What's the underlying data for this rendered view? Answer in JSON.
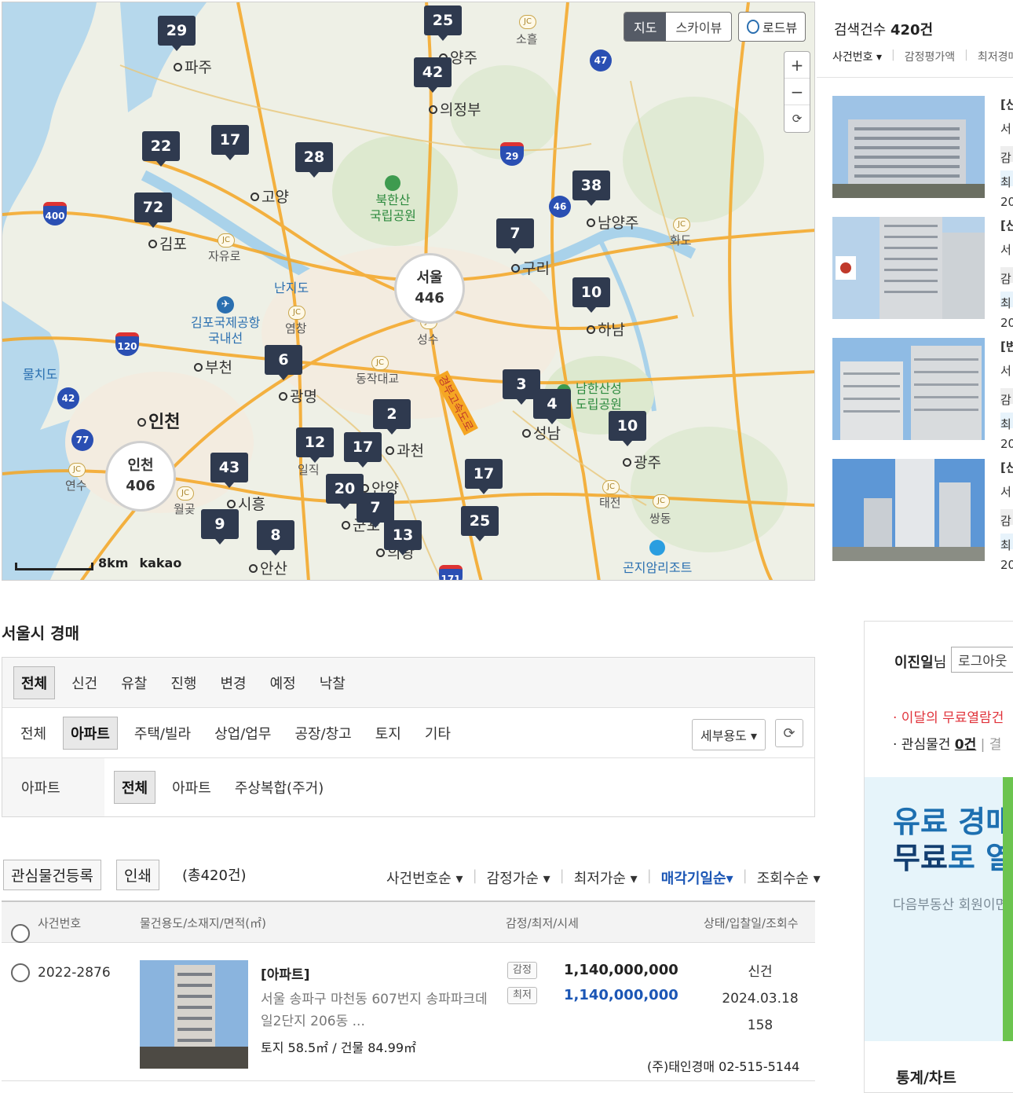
{
  "map": {
    "view_tabs": [
      "지도",
      "스카이뷰"
    ],
    "roadview_label": "로드뷰",
    "zoom_in": "+",
    "zoom_out": "−",
    "reset": "⟳",
    "scale_label": "8km",
    "brand": "kakao",
    "clusters": {
      "seoul": {
        "name": "서울",
        "count": "446"
      },
      "incheon": {
        "name": "인천",
        "count": "406"
      }
    },
    "markers": [
      "29",
      "25",
      "42",
      "22",
      "17",
      "28",
      "72",
      "38",
      "7",
      "10",
      "6",
      "3",
      "4",
      "2",
      "10",
      "12",
      "17",
      "43",
      "20",
      "7",
      "17",
      "25",
      "9",
      "8",
      "13"
    ],
    "cities": [
      "파주",
      "양주",
      "의정부",
      "고양",
      "김포",
      "남양주",
      "구리",
      "하남",
      "부천",
      "광명",
      "인천",
      "성남",
      "과천",
      "광주",
      "시흥",
      "안양",
      "군포",
      "의왕",
      "안산"
    ],
    "jc_labels": [
      "소흘",
      "자유로",
      "염창",
      "동작대교",
      "성수",
      "화도",
      "태전",
      "쌍동",
      "연수",
      "월곶",
      "일직"
    ],
    "parks": [
      "북한산\n국립공원",
      "남한산성\n도립공원",
      "김포국제공항\n국내선",
      "곤지암리조트"
    ],
    "water": [
      "난지도",
      "물치도"
    ],
    "expressway": "경부고속도로",
    "highways": [
      "400",
      "120",
      "42",
      "77",
      "29",
      "46",
      "47",
      "17",
      "171"
    ]
  },
  "results": {
    "count_label": "검색건수",
    "count_value": "420건",
    "sorts": [
      "사건번호 ▾",
      "감정평가액",
      "최저경매"
    ],
    "items": [
      {
        "lines": [
          "[신",
          "서",
          "감",
          "최",
          "20"
        ]
      },
      {
        "lines": [
          "[신",
          "서",
          "감",
          "최",
          "20"
        ]
      },
      {
        "lines": [
          "[변",
          "서",
          "감",
          "최",
          "20"
        ]
      },
      {
        "lines": [
          "[신",
          "서",
          "감",
          "최",
          "20"
        ]
      }
    ]
  },
  "section_title": "서울시 경매",
  "filter": {
    "status_tabs": [
      "전체",
      "신건",
      "유찰",
      "진행",
      "변경",
      "예정",
      "낙찰"
    ],
    "type_tabs": [
      "전체",
      "아파트",
      "주택/빌라",
      "상업/업무",
      "공장/창고",
      "토지",
      "기타"
    ],
    "detail_button": "세부용도 ▾",
    "sub_label": "아파트",
    "sub_tabs": [
      "전체",
      "아파트",
      "주상복합(주거)"
    ]
  },
  "actions": {
    "watch_button": "관심물건등록",
    "print_button": "인쇄",
    "total": "(총420건)",
    "sort_options": [
      "사건번호순 ▾",
      "감정가순 ▾",
      "최저가순 ▾",
      "매각기일순▾",
      "조회수순 ▾"
    ]
  },
  "table": {
    "headers": [
      "사건번호",
      "물건용도/소재지/면적(㎡)",
      "감정/최저/시세",
      "상태/입찰일/조회수"
    ],
    "rows": [
      {
        "case_no": "2022-2876",
        "type": "[아파트]",
        "address": "서울 송파구 마천동 607번지 송파파크데일2단지 206동 ...",
        "area": "토지 58.5㎡ / 건물 84.99㎡",
        "appraisal_label": "감정",
        "appraisal": "1,140,000,000",
        "minimum_label": "최저",
        "minimum": "1,140,000,000",
        "status": "신건",
        "bid_date": "2024.03.18",
        "views": "158",
        "agent": "(주)태인경매 02-515-5144"
      }
    ]
  },
  "side": {
    "user_name": "이진일",
    "user_suffix": "님",
    "logout": "로그아웃",
    "free_view": "· 이달의 무료열람건",
    "watch_prefix": "· 관심물건 ",
    "watch_count": "0건",
    "watch_suffix": " | 결",
    "ad_line1": "유료 경매",
    "ad_line2_a": "무료",
    "ad_line2_b": "로 열",
    "ad_sub": "다음부동산 회원이면",
    "stats": "통계/차트"
  },
  "colors": {
    "marker": "#2f3a4f",
    "accent": "#1b56b5",
    "alert": "#e0323a"
  }
}
